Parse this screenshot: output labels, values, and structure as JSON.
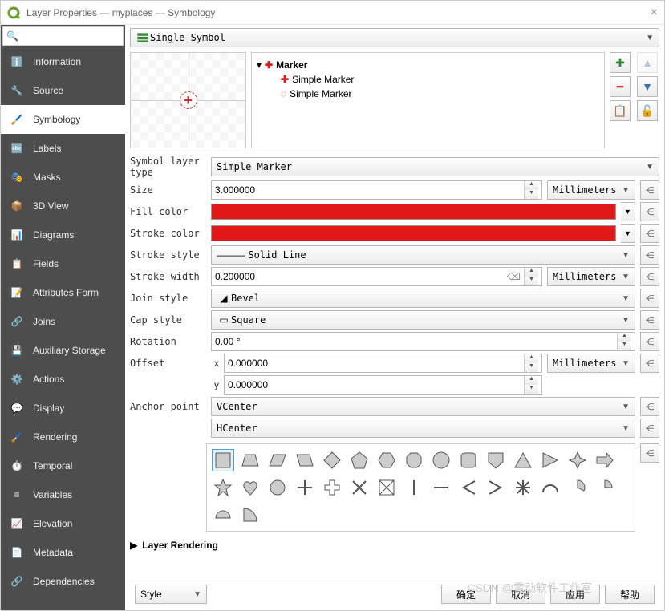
{
  "window": {
    "title": "Layer Properties — myplaces — Symbology"
  },
  "sidebar": {
    "search_placeholder": "",
    "items": [
      {
        "label": "Information"
      },
      {
        "label": "Source"
      },
      {
        "label": "Symbology"
      },
      {
        "label": "Labels"
      },
      {
        "label": "Masks"
      },
      {
        "label": "3D View"
      },
      {
        "label": "Diagrams"
      },
      {
        "label": "Fields"
      },
      {
        "label": "Attributes Form"
      },
      {
        "label": "Joins"
      },
      {
        "label": "Auxiliary Storage"
      },
      {
        "label": "Actions"
      },
      {
        "label": "Display"
      },
      {
        "label": "Rendering"
      },
      {
        "label": "Temporal"
      },
      {
        "label": "Variables"
      },
      {
        "label": "Elevation"
      },
      {
        "label": "Metadata"
      },
      {
        "label": "Dependencies"
      }
    ],
    "active_index": 2
  },
  "symbology": {
    "symbol_mode": "Single Symbol",
    "tree": {
      "root": "Marker",
      "children": [
        "Simple Marker",
        "Simple Marker"
      ]
    },
    "symbol_layer_type_label": "Symbol layer type",
    "symbol_layer_type": "Simple Marker",
    "props": {
      "size_label": "Size",
      "size_value": "3.000000",
      "size_unit": "Millimeters",
      "fill_label": "Fill color",
      "fill_color": "#e01818",
      "stroke_color_label": "Stroke color",
      "stroke_color": "#e01818",
      "stroke_style_label": "Stroke style",
      "stroke_style": "Solid Line",
      "stroke_width_label": "Stroke width",
      "stroke_width": "0.200000",
      "stroke_width_unit": "Millimeters",
      "join_style_label": "Join style",
      "join_style": "Bevel",
      "cap_style_label": "Cap style",
      "cap_style": "Square",
      "rotation_label": "Rotation",
      "rotation": "0.00 °",
      "offset_label": "Offset",
      "offset_x_label": "x",
      "offset_x": "0.000000",
      "offset_y_label": "y",
      "offset_y": "0.000000",
      "offset_unit": "Millimeters",
      "anchor_label": "Anchor point",
      "anchor_v": "VCenter",
      "anchor_h": "HCenter"
    },
    "section_rendering": "Layer Rendering"
  },
  "footer": {
    "style": "Style",
    "ok": "确定",
    "cancel": "取消",
    "apply": "应用",
    "help": "帮助"
  },
  "watermark": "CSDN @雷动软件工作室"
}
